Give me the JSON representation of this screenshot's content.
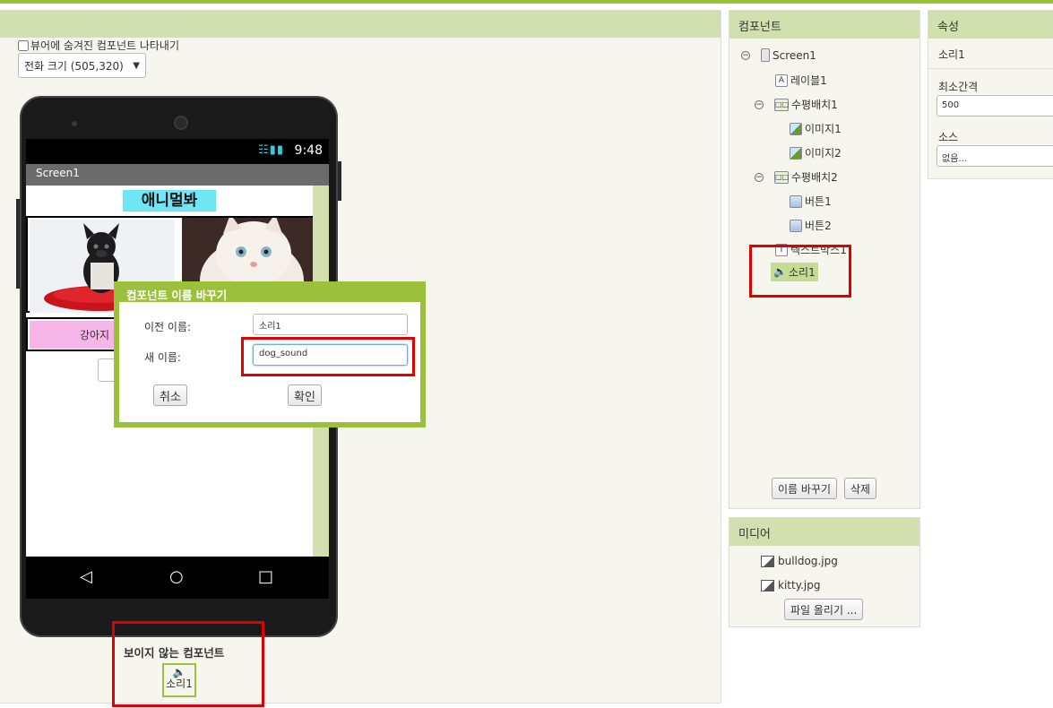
{
  "viewer": {
    "hidden_toggle_label": "뷰어에 숨겨진 컴포넌트 나타내기",
    "size_select_value": "전화 크기 (505,320)",
    "status_time": "9:48",
    "screen_title": "Screen1",
    "app_title": "애니멀봐",
    "dog_button_label": "강아지",
    "nonvisible_title": "보이지 않는 컴포넌트",
    "nonvisible_item": "소리1"
  },
  "dialog": {
    "title": "컴포넌트 이름 바꾸기",
    "old_name_label": "이전 이름:",
    "old_name_value": "소리1",
    "new_name_label": "새 이름:",
    "new_name_value": "dog_sound",
    "cancel_label": "취소",
    "ok_label": "확인"
  },
  "components": {
    "header": "컴포넌트",
    "tree": [
      {
        "label": "Screen1",
        "icon": "phone-icon"
      },
      {
        "label": "레이블1",
        "icon": "label-icon"
      },
      {
        "label": "수평배치1",
        "icon": "horizontal-arrangement-icon"
      },
      {
        "label": "이미지1",
        "icon": "image-icon"
      },
      {
        "label": "이미지2",
        "icon": "image-icon"
      },
      {
        "label": "수평배치2",
        "icon": "horizontal-arrangement-icon"
      },
      {
        "label": "버튼1",
        "icon": "button-icon"
      },
      {
        "label": "버튼2",
        "icon": "button-icon"
      },
      {
        "label": "텍스트박스1",
        "icon": "textbox-icon"
      },
      {
        "label": "소리1",
        "icon": "sound-icon"
      }
    ],
    "rename_label": "이름 바꾸기",
    "delete_label": "삭제"
  },
  "media": {
    "header": "미디어",
    "files": [
      "bulldog.jpg",
      "kitty.jpg"
    ],
    "upload_label": "파일 올리기 ..."
  },
  "properties": {
    "header": "속성",
    "component_name": "소리1",
    "min_interval_label": "최소간격",
    "min_interval_value": "500",
    "source_label": "소스",
    "source_value": "없음..."
  },
  "colors": {
    "accent_green": "#9bc13c",
    "header_green": "#d2e0b0",
    "highlight_red": "#e00000"
  }
}
